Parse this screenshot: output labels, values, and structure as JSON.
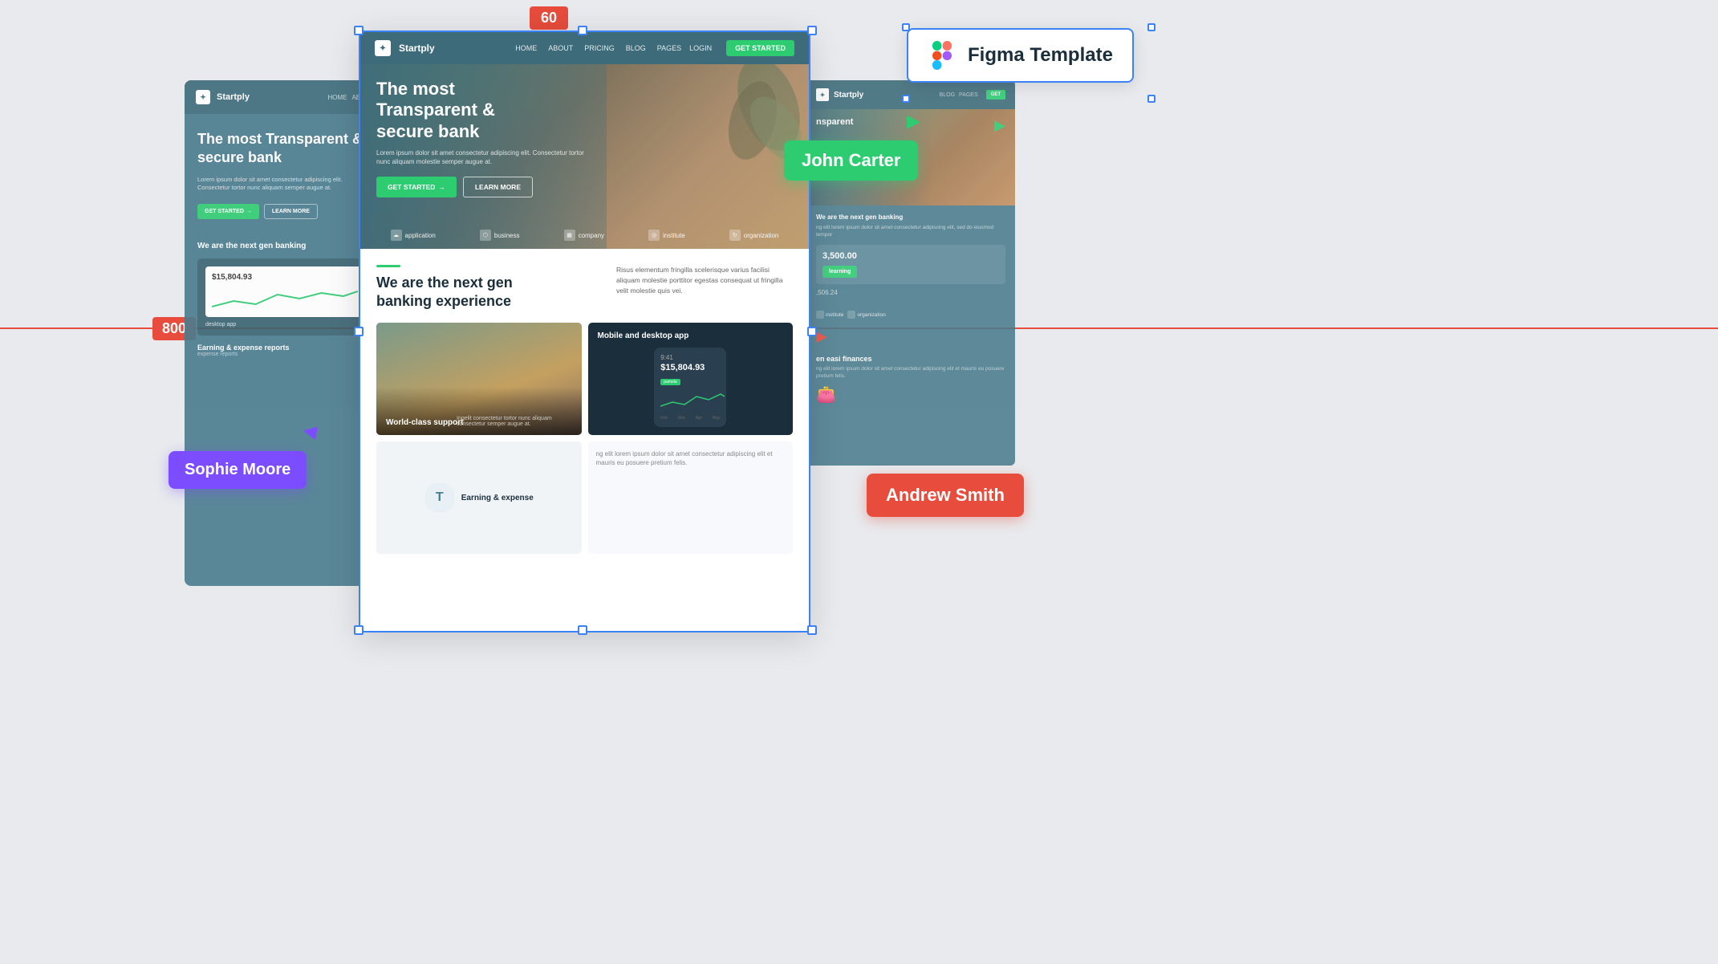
{
  "canvas": {
    "background": "#e8eaed"
  },
  "badges": {
    "dimension_60": "60",
    "dimension_800": "800"
  },
  "figma_badge": {
    "label": "Figma Template",
    "icon": "figma-icon"
  },
  "user_badges": {
    "sophie": "Sophie Moore",
    "john": "John Carter",
    "andrew": "Andrew Smith"
  },
  "main_card": {
    "nav": {
      "brand": "Startply",
      "links": [
        "HOME",
        "ABOUT",
        "PRICING",
        "BLOG",
        "PAGES"
      ],
      "login": "LOGIN",
      "cta": "GET STARTED"
    },
    "hero": {
      "title_line1": "The most",
      "title_line2": "Transparent &",
      "title_line3": "secure bank",
      "description": "Lorem ipsum dolor sit amet consectetur adipiscing elit. Consectetur tortor nunc aliquam molestie semper augue at.",
      "btn_primary": "GET STARTED",
      "btn_secondary": "LEARN MORE",
      "pills": [
        "application",
        "business",
        "company",
        "institute",
        "organization"
      ]
    },
    "lower": {
      "accent": "",
      "title_line1": "We are the next gen",
      "title_line2": "banking experience",
      "description": "Risus elementum fringilla scelerisque varius facilisi aliquam molestie porttitor egestas consequat ut fringilla velit molestie quis vei.",
      "cards": [
        {
          "label": "World-class support",
          "type": "photo"
        },
        {
          "label": "Mobile and desktop app",
          "type": "dark",
          "amount": "$15,804.93"
        },
        {
          "label": "Earning & expense",
          "type": "earn"
        },
        {
          "label": "",
          "type": "app"
        }
      ]
    }
  },
  "left_card": {
    "brand": "Startply",
    "hero_title": "The most Transparent & secure bank",
    "hero_desc": "Lorem ipsum dolor sit amet consectetur adipiscing elit. Consectetur tortor nunc aliquam semper augue at.",
    "btn1": "GET STARTED",
    "btn2": "LEARN MORE",
    "lower_title": "We are the next gen banking",
    "app_amount": "$15,804.93",
    "app_label": "desktop app",
    "report_title": "Earning & expense reports"
  },
  "right_card": {
    "brand": "Startply",
    "hero_title": "nsparent",
    "lower_text": "ng elit lorem ipsum dolor sit amet consectetur adipiscing elit, sed do eiusmod tempor",
    "amount": "3,500.00",
    "amount2": ",506.24",
    "institute_label": "institute",
    "organization_label": "organization",
    "lower2_title": "en easi finances",
    "lower2_text": "ng elit lorem ipsum dolor sit amet consectetur adipiscing elit et mauris eu posuere pretium felis."
  }
}
